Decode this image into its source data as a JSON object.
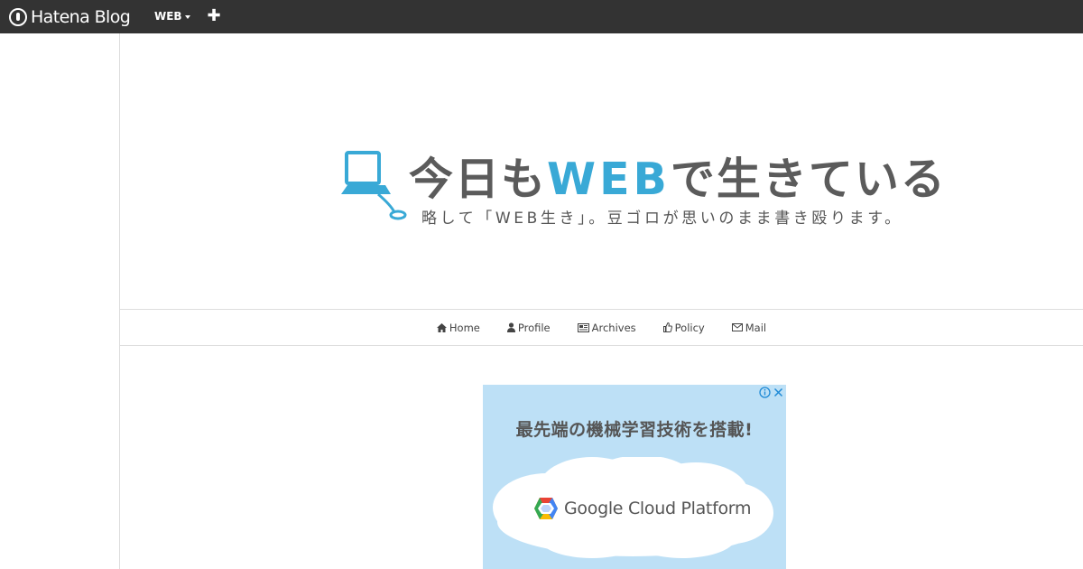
{
  "topbar": {
    "brand": "Hatena Blog",
    "blog_menu": "WEB",
    "add_icon": "plus-icon"
  },
  "header": {
    "title_prefix": "今日も",
    "title_highlight": "WEB",
    "title_suffix": "で生きている",
    "subtitle": "略して「WEB生き」。豆ゴロが思いのまま書き殴ります。",
    "logo_icon": "computer-icon",
    "colors": {
      "accent": "#39a9d6",
      "text": "#5b5b5b"
    }
  },
  "nav": {
    "items": [
      {
        "label": "Home",
        "icon": "home-icon"
      },
      {
        "label": "Profile",
        "icon": "user-icon"
      },
      {
        "label": "Archives",
        "icon": "newspaper-icon"
      },
      {
        "label": "Policy",
        "icon": "thumbs-up-icon"
      },
      {
        "label": "Mail",
        "icon": "envelope-icon"
      }
    ]
  },
  "ad": {
    "headline": "最先端の機械学習技術を搭載!",
    "product": "Google Cloud Platform",
    "background": "#bde0f6"
  }
}
